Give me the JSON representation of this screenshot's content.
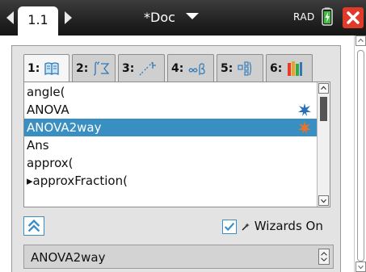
{
  "topbar": {
    "page_tab": "1.1",
    "doc_title": "*Doc",
    "angle_mode": "RAD"
  },
  "catalog": {
    "tabs": [
      {
        "label": "1:",
        "icon": "book-icon"
      },
      {
        "label": "2:",
        "icon": "integral-sum-icon"
      },
      {
        "label": "3:",
        "icon": "function-graph-icon"
      },
      {
        "label": "4:",
        "icon": "infinity-beta-icon"
      },
      {
        "label": "5:",
        "icon": "template-grid-icon"
      },
      {
        "label": "6:",
        "icon": "library-books-icon"
      }
    ],
    "active_tab": 0,
    "items": [
      {
        "label": "angle(",
        "wizard": false
      },
      {
        "label": "ANOVA",
        "wizard": true
      },
      {
        "label": "ANOVA2way",
        "wizard": true
      },
      {
        "label": "Ans",
        "wizard": false
      },
      {
        "label": "approx(",
        "wizard": false
      },
      {
        "label": "▸approxFraction(",
        "wizard": false
      }
    ],
    "selected_index": 2,
    "wizards_label": "Wizards On",
    "wizards_checked": true,
    "entry_value": "ANOVA2way"
  },
  "colors": {
    "selection": "#3a8fc2",
    "wizard_star": "#2b6fb3",
    "wizard_star_selected": "#e8732a",
    "close_red": "#e03a2a"
  }
}
